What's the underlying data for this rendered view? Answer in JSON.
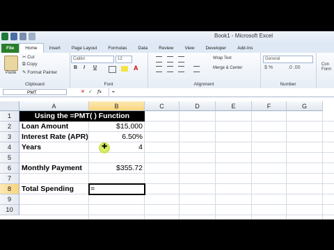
{
  "window": {
    "title": "Book1 - Microsoft Excel"
  },
  "tabs": [
    "File",
    "Home",
    "Insert",
    "Page Layout",
    "Formulas",
    "Data",
    "Review",
    "View",
    "Developer",
    "Add-Ins"
  ],
  "ribbon": {
    "clipboard": {
      "paste": "Paste",
      "cut": "Cut",
      "copy": "Copy",
      "format_painter": "Format Painter",
      "label": "Clipboard"
    },
    "font": {
      "name": "Calibri",
      "size": "12",
      "bold": "B",
      "italic": "I",
      "underline": "U",
      "label": "Font"
    },
    "alignment": {
      "wrap_text": "Wrap Text",
      "merge_center": "Merge & Center",
      "label": "Alignment"
    },
    "number": {
      "format": "General",
      "label": "Number"
    },
    "styles": {
      "partial": "Con Form"
    }
  },
  "formula_bar": {
    "name_box": "PMT",
    "fx": "fx",
    "content": "="
  },
  "columns": [
    "A",
    "B",
    "C",
    "D",
    "E",
    "F",
    "G"
  ],
  "rows": [
    "1",
    "2",
    "3",
    "4",
    "5",
    "6",
    "7",
    "8",
    "9",
    "10"
  ],
  "cells": {
    "title": "Using the =PMT( ) Function",
    "loan_label": "Loan Amount",
    "loan_value": "$15,000",
    "rate_label": "Interest Rate (APR)",
    "rate_value": "6.50%",
    "years_label": "Years",
    "years_value": "4",
    "payment_label": "Monthly Payment",
    "payment_value": "$355.72",
    "spending_label": "Total Spending",
    "spending_value": "="
  },
  "colors": {
    "file_tab": "#2a7d2a",
    "cursor_highlight": "#d9ee6c",
    "selected_header": "#f8d47c"
  }
}
